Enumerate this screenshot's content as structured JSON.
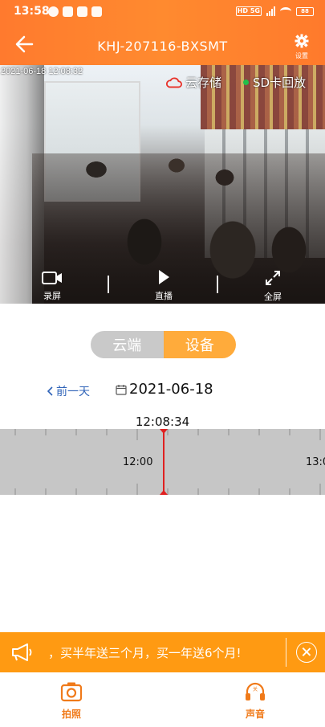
{
  "status_bar": {
    "time": "13:58",
    "network": "HD 5G",
    "battery": "88"
  },
  "nav": {
    "title": "KHJ-207116-BXSMT",
    "settings_label": "设置"
  },
  "video": {
    "timestamp": "2021-06-18 12:08:32",
    "cloud_storage_label": "云存储",
    "sd_replay_label": "SD卡回放",
    "controls": [
      {
        "label": "录屏"
      },
      {
        "label": "直播"
      },
      {
        "label": "全屏"
      }
    ]
  },
  "source_toggle": {
    "options": [
      "云端",
      "设备"
    ],
    "selected": "设备"
  },
  "date_row": {
    "prev_day_label": "前一天",
    "date": "2021-06-18"
  },
  "timeline": {
    "current_time": "12:08:34",
    "labels": [
      "12:00",
      "13:0"
    ]
  },
  "promo": {
    "text": "，买半年送三个月，买一年送6个月!"
  },
  "bottom_bar": {
    "items": [
      {
        "label": "拍照"
      },
      {
        "label": "声音"
      }
    ]
  },
  "colors": {
    "brand_orange": "#ff7a2e",
    "toggle_selected": "#ffab3b",
    "promo_bg": "#ff9a12",
    "playhead": "#e02020",
    "link_blue": "#2f63b8"
  }
}
